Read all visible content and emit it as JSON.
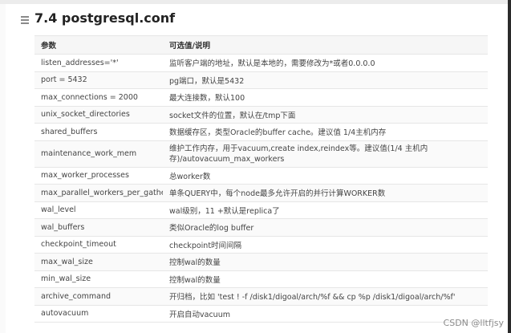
{
  "heading": "7.4 postgresql.conf",
  "table": {
    "headers": [
      "参数",
      "可选值/说明"
    ],
    "rows": [
      {
        "param": "listen_addresses='*'",
        "desc": "监听客户端的地址，默认是本地的，需要修改为*或者0.0.0.0"
      },
      {
        "param": "port = 5432",
        "desc": "pg端口，默认是5432"
      },
      {
        "param": "max_connections = 2000",
        "desc": "最大连接数，默认100"
      },
      {
        "param": "unix_socket_directories",
        "desc": "socket文件的位置，默认在/tmp下面"
      },
      {
        "param": "shared_buffers",
        "desc": "数据缓存区，类型Oracle的buffer cache。建议值 1/4主机内存"
      },
      {
        "param": "maintenance_work_mem",
        "desc": "维护工作内存，用于vacuum,create index,reindex等。建议值(1/4 主机内存)/autovacuum_max_workers"
      },
      {
        "param": "max_worker_processes",
        "desc": "总worker数"
      },
      {
        "param": "max_parallel_workers_per_gather",
        "desc": "单条QUERY中，每个node最多允许开启的并行计算WORKER数"
      },
      {
        "param": "wal_level",
        "desc": "wal级别，11 +默认是replica了"
      },
      {
        "param": "wal_buffers",
        "desc": "类似Oracle的log buffer"
      },
      {
        "param": "checkpoint_timeout",
        "desc": "checkpoint时间间隔"
      },
      {
        "param": "max_wal_size",
        "desc": "控制wal的数量"
      },
      {
        "param": "min_wal_size",
        "desc": "控制wal的数量"
      },
      {
        "param": "archive_command",
        "desc": "开归档，比如 'test ! -f /disk1/digoal/arch/%f && cp %p /disk1/digoal/arch/%f'"
      },
      {
        "param": "autovacuum",
        "desc": "开启自动vacuum"
      }
    ]
  },
  "watermark": "CSDN @lltfjsy"
}
